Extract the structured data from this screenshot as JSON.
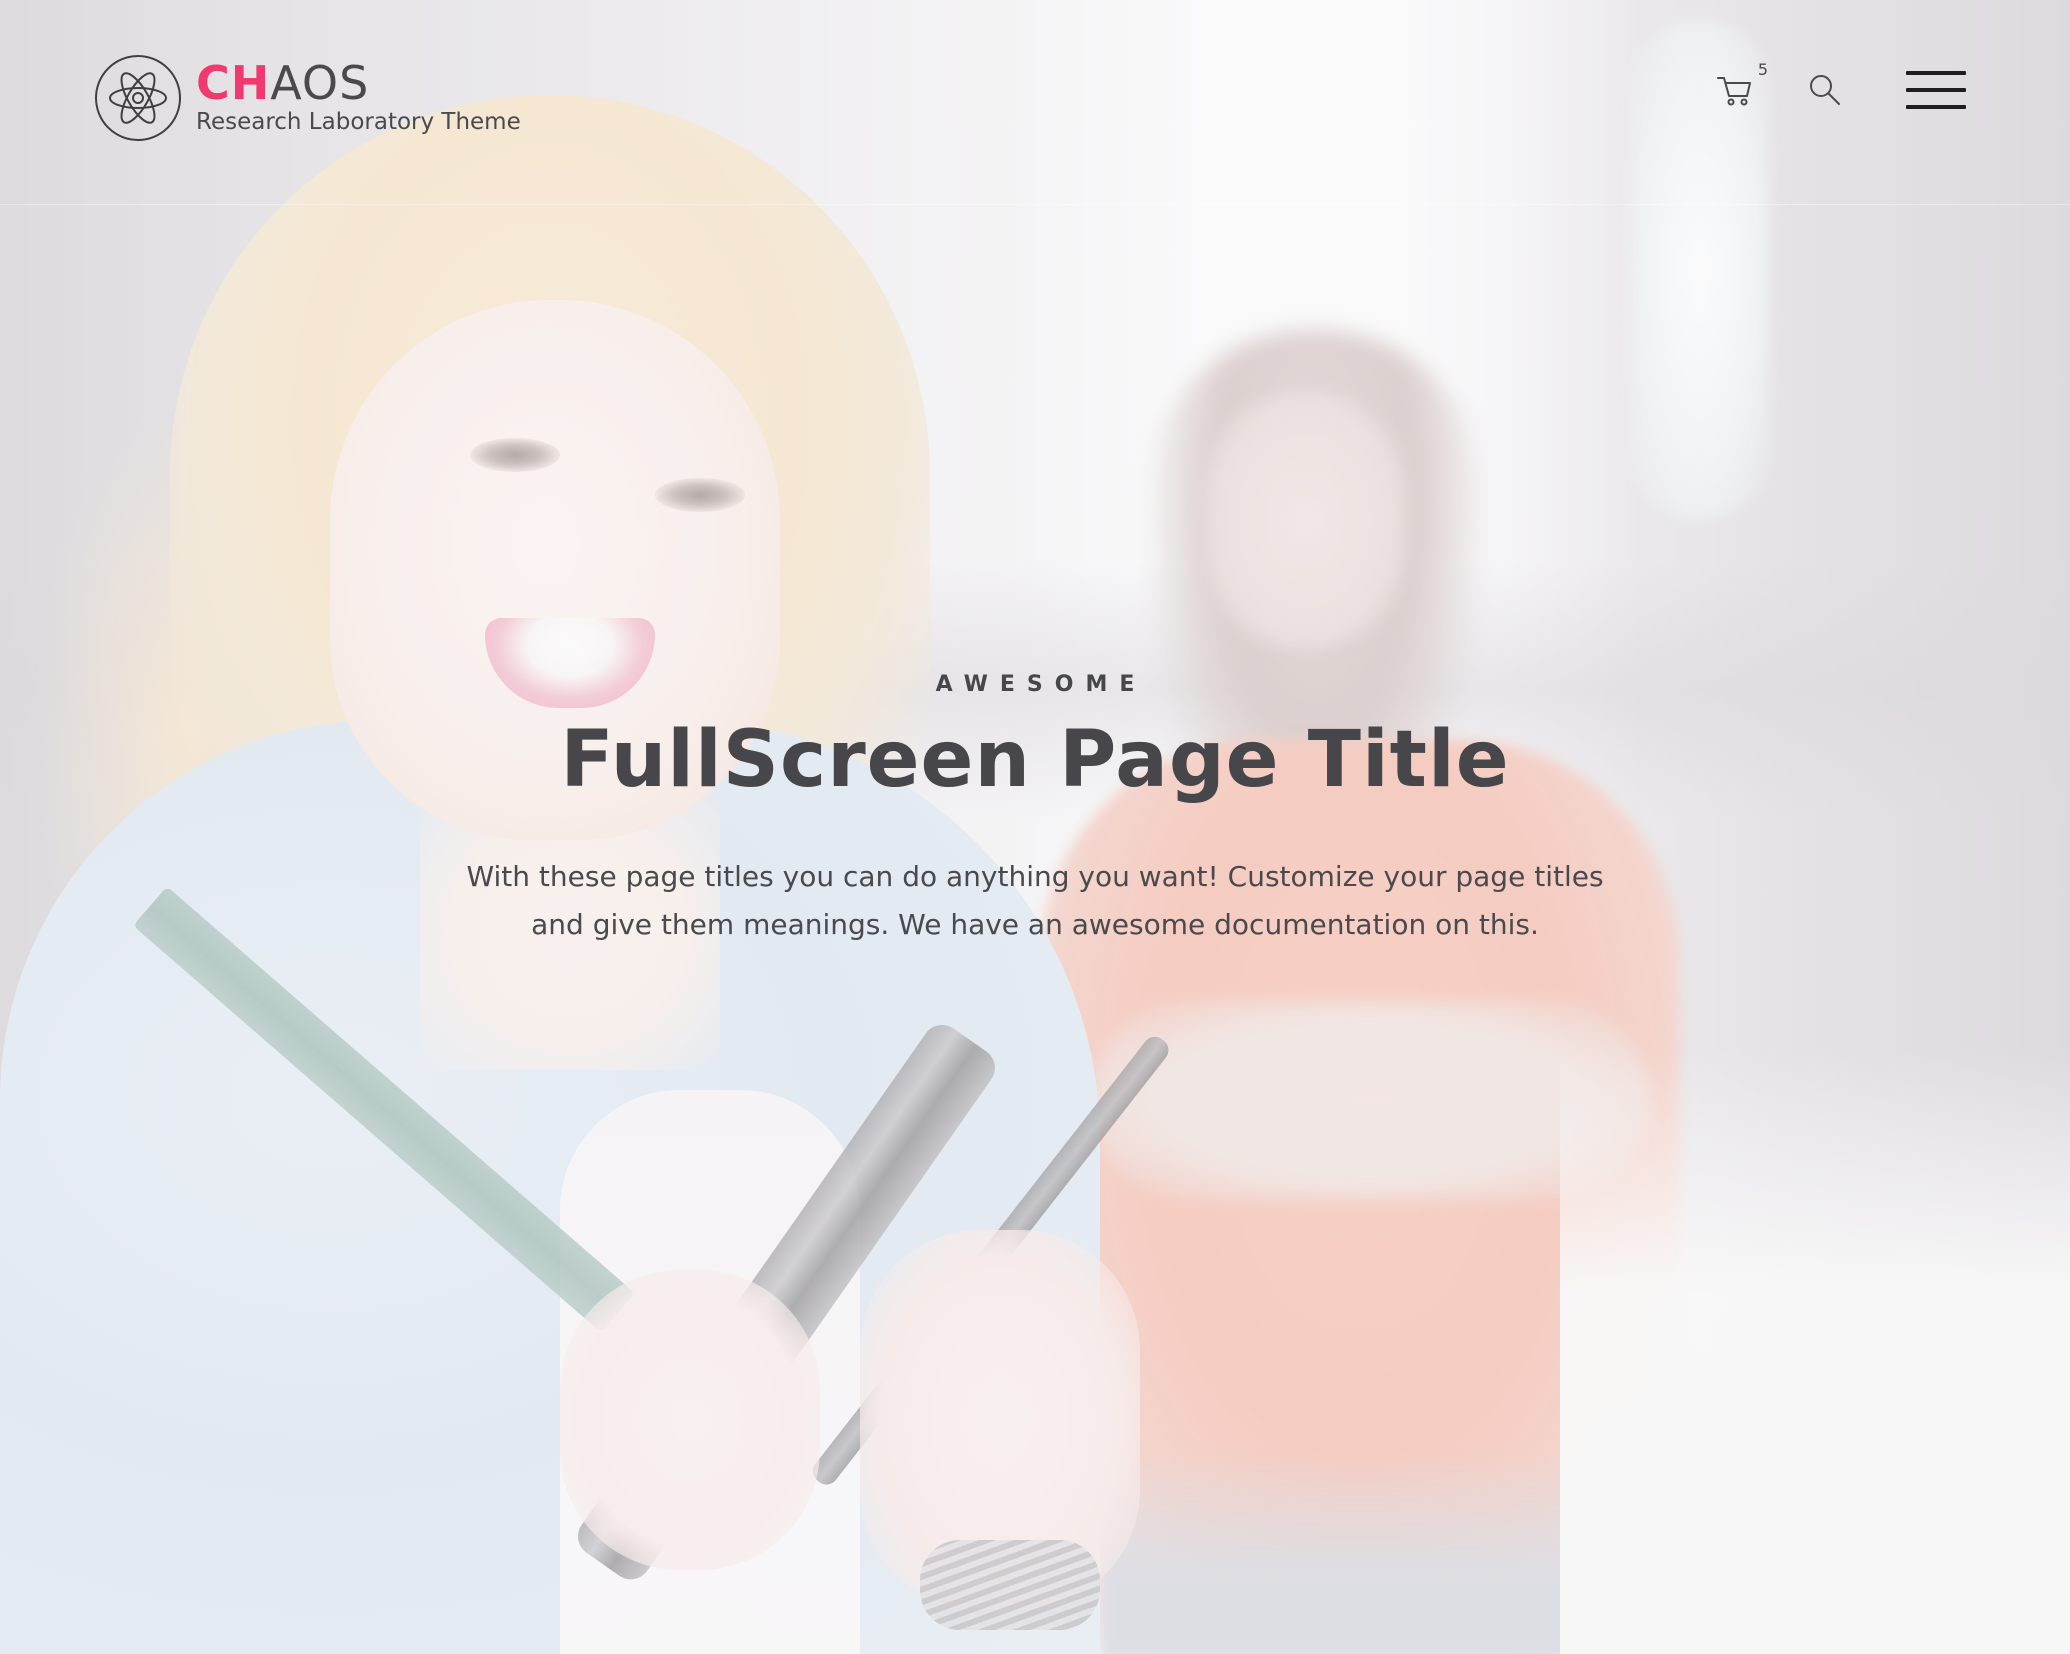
{
  "brand": {
    "name_accent": "CH",
    "name_rest": "AOS",
    "tagline": "Research Laboratory Theme",
    "accent_color": "#f0396f",
    "logo_icon": "atom-icon"
  },
  "header": {
    "cart_icon": "cart-icon",
    "cart_count": "5",
    "search_icon": "search-icon",
    "menu_icon": "hamburger-menu-icon"
  },
  "hero": {
    "eyebrow": "AWESOME",
    "title": "FullScreen Page Title",
    "description": "With these page titles you can do anything you want! Customize your page titles and give them meanings. We have an awesome documentation on this."
  }
}
